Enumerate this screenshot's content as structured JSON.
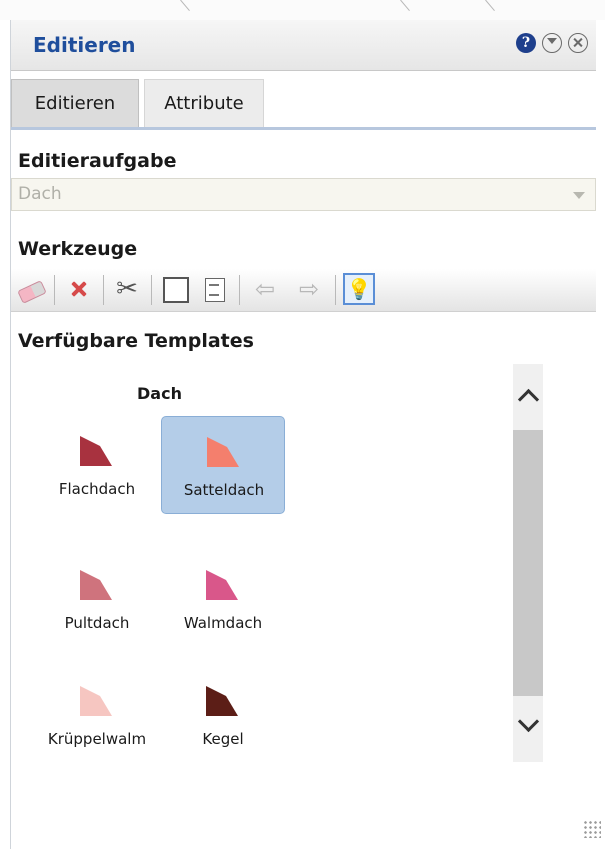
{
  "window": {
    "title": "Editieren"
  },
  "tabs": [
    {
      "label": "Editieren",
      "active": true
    },
    {
      "label": "Attribute",
      "active": false
    }
  ],
  "edit_task": {
    "section_title": "Editieraufgabe",
    "selected_value": "Dach"
  },
  "tools": {
    "section_title": "Werkzeuge",
    "items": [
      "eraser-icon",
      "delete-icon",
      "scissors-icon",
      "rectangle-icon",
      "note-icon",
      "undo-icon",
      "redo-icon",
      "lightbulb-icon"
    ],
    "active": "lightbulb-icon"
  },
  "templates": {
    "section_title": "Verfügbare Templates",
    "group_label": "Dach",
    "items": [
      {
        "label": "Flachdach",
        "color": "#a8323f",
        "selected": false
      },
      {
        "label": "Satteldach",
        "color": "#f47f6d",
        "selected": true
      },
      {
        "label": "Pultdach",
        "color": "#cf737d",
        "selected": false
      },
      {
        "label": "Walmdach",
        "color": "#d9578a",
        "selected": false
      },
      {
        "label": "Krüppelwalm",
        "color": "#f6c6c1",
        "selected": false
      },
      {
        "label": "Kegel",
        "color": "#5c1e17",
        "selected": false
      }
    ]
  }
}
